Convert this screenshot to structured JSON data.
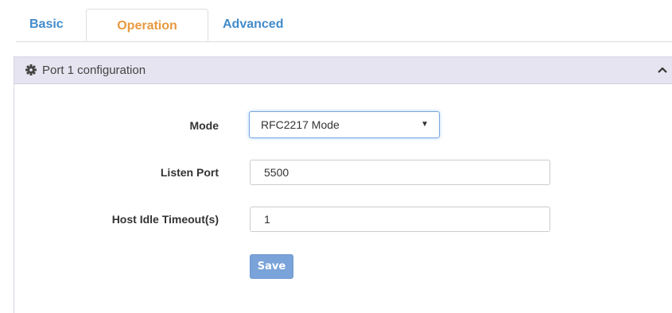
{
  "tabs": [
    {
      "label": "Basic",
      "active": false
    },
    {
      "label": "Operation",
      "active": true
    },
    {
      "label": "Advanced",
      "active": false
    }
  ],
  "panel": {
    "title": "Port 1 configuration",
    "icon": "gear-icon",
    "collapse_icon": "chevron-up-icon"
  },
  "form": {
    "mode": {
      "label": "Mode",
      "value": "RFC2217 Mode"
    },
    "listen_port": {
      "label": "Listen Port",
      "value": "5500"
    },
    "host_idle_timeout": {
      "label": "Host Idle Timeout(s)",
      "value": "1"
    },
    "save_label": "Save"
  },
  "colors": {
    "accent": "#428bca",
    "active_tab": "#e8993f",
    "panel_header": "#e6e4f0",
    "save_button": "#7aa3d9"
  }
}
